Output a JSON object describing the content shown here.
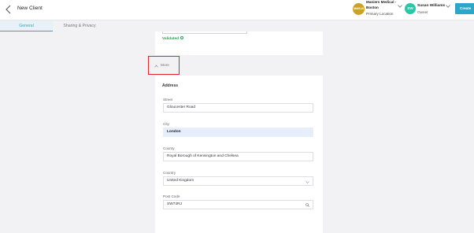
{
  "header": {
    "title": "New Client",
    "location": {
      "avatar": "MMS-B",
      "name": "Maniers Medical - Boston",
      "role": "Primary Location"
    },
    "user": {
      "avatar": "SW",
      "name": "Susan Williams",
      "role": "Owner"
    },
    "create_label": "Create",
    "accent": "#2aa7c9"
  },
  "tabs": [
    {
      "label": "General",
      "active": true
    },
    {
      "label": "Sharing & Privacy",
      "active": false
    }
  ],
  "validation": {
    "status": "Validated",
    "color": "#2e9d5a"
  },
  "more_toggle": {
    "label": "More",
    "icon": "chevron-up-icon"
  },
  "address": {
    "title": "Address",
    "fields": {
      "street": {
        "label": "Street",
        "value": "Gloucester Road"
      },
      "city": {
        "label": "City",
        "value": "London"
      },
      "county": {
        "label": "County",
        "value": "Royal Borough of Kensington and Chelsea"
      },
      "country": {
        "label": "Country",
        "value": "United Kingdom"
      },
      "postcode": {
        "label": "Post Code",
        "value": "SW74RJ"
      }
    }
  }
}
